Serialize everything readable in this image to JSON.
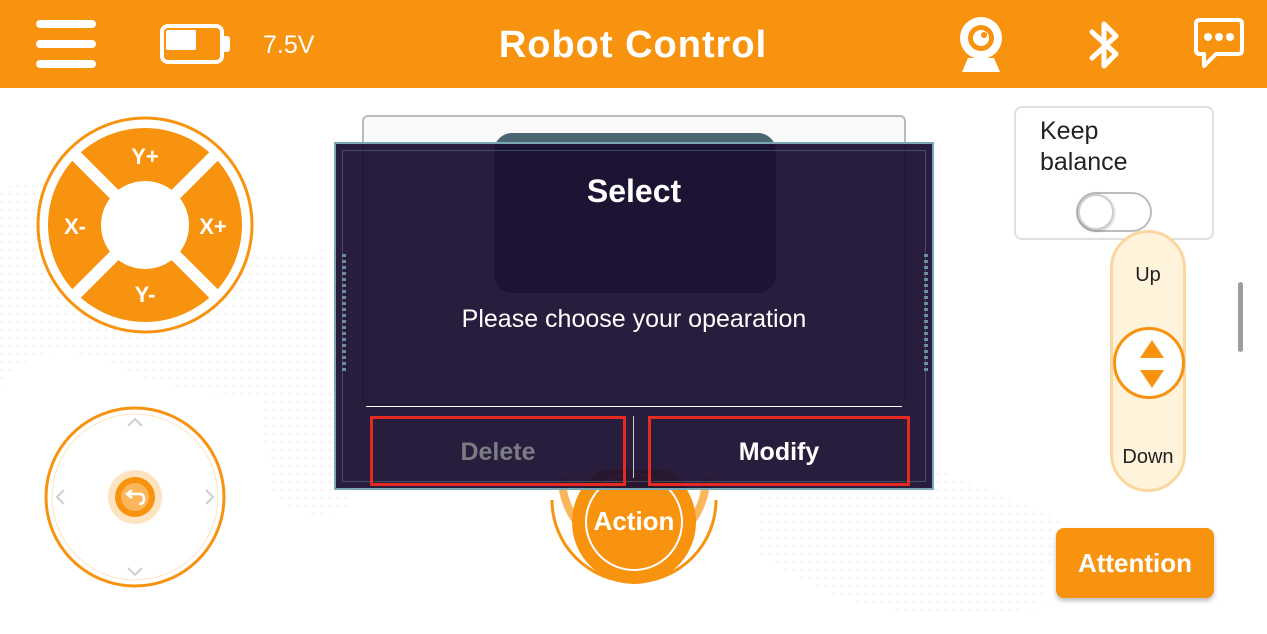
{
  "header": {
    "menu_icon": "hamburger-menu-icon",
    "battery_icon": "battery-icon",
    "battery_level": 0.5,
    "voltage": "7.5V",
    "title": "Robot Control",
    "icons": [
      "webcam-icon",
      "bluetooth-icon",
      "chat-icon"
    ]
  },
  "dpad": {
    "up": "Y+",
    "down": "Y-",
    "left": "X-",
    "right": "X+"
  },
  "keep_balance": {
    "label": "Keep balance",
    "enabled": false
  },
  "height_control": {
    "up_label": "Up",
    "down_label": "Down"
  },
  "action_button": "Action",
  "attention_button": "Attention",
  "dialog": {
    "title": "Select",
    "message": "Please choose your opearation",
    "delete_label": "Delete",
    "modify_label": "Modify"
  },
  "colors": {
    "accent": "#f7930f",
    "dialog_bg": "#1b0f30",
    "highlight_border": "#e52b21"
  }
}
